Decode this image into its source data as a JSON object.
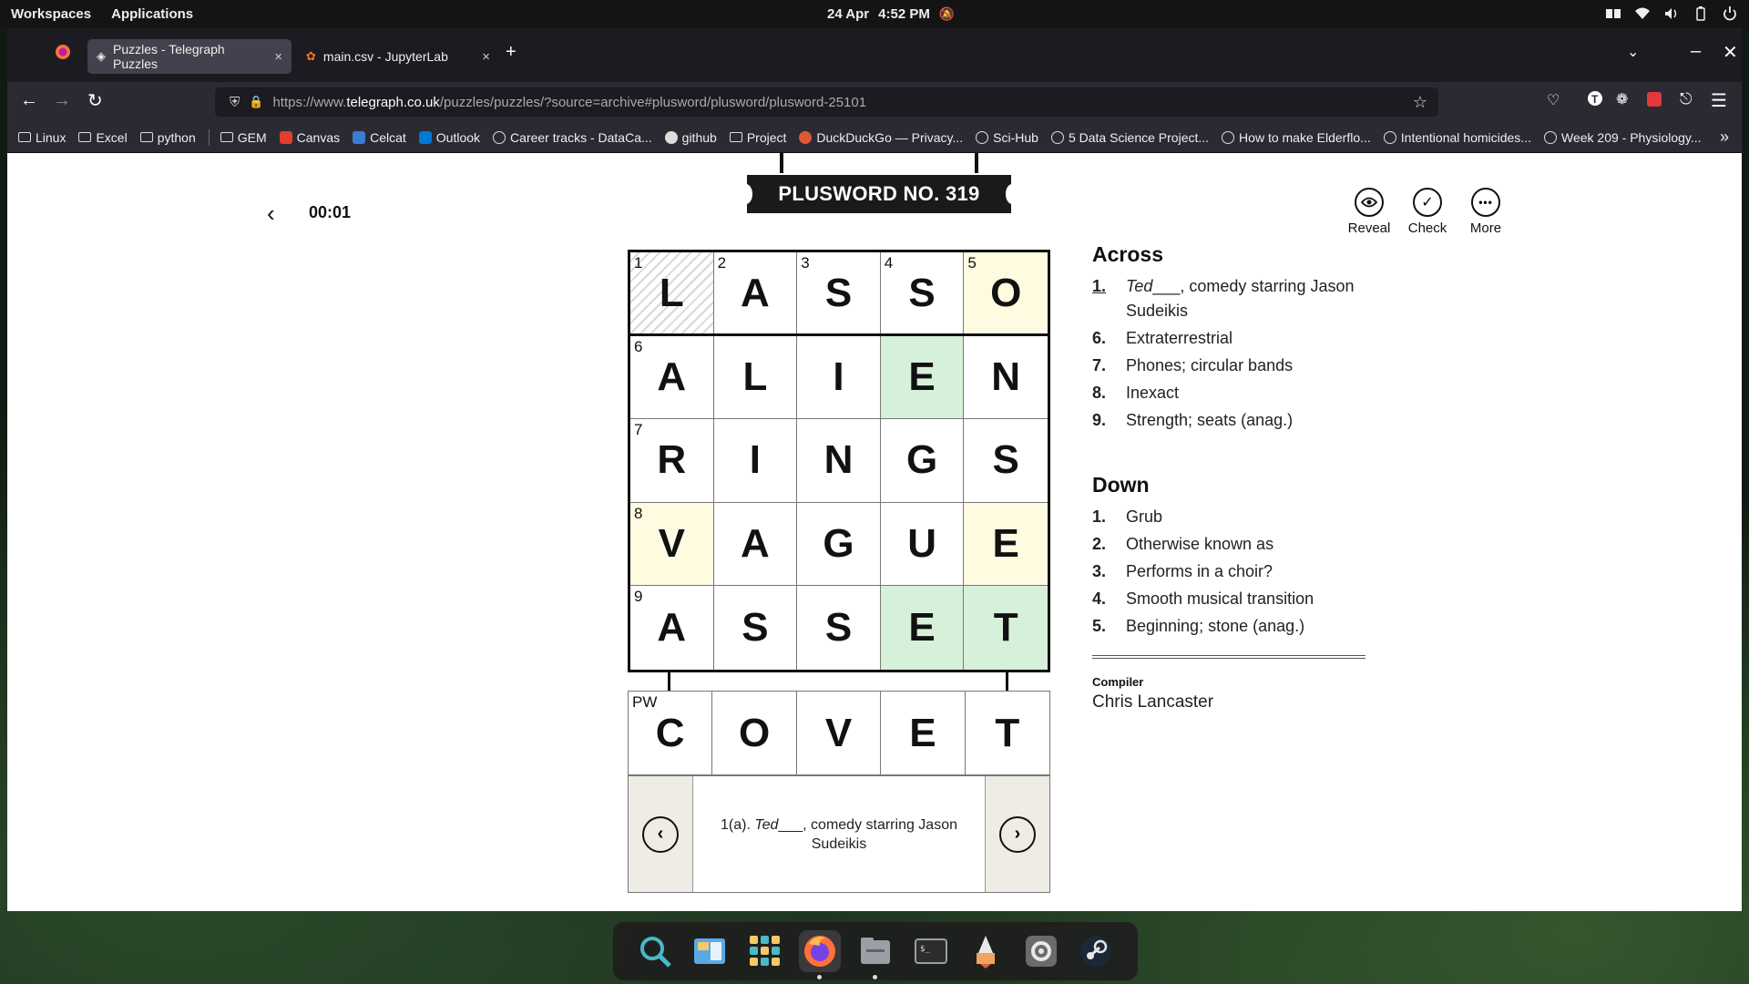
{
  "topbar": {
    "workspaces": "Workspaces",
    "applications": "Applications",
    "date": "24 Apr",
    "time": "4:52 PM"
  },
  "browser": {
    "tabs": [
      {
        "title": "Puzzles - Telegraph Puzzles",
        "close": "×"
      },
      {
        "title": "main.csv - JupyterLab",
        "close": "×"
      }
    ],
    "new_tab": "+",
    "url_prefix": "https://www.",
    "url_domain": "telegraph.co.uk",
    "url_path": "/puzzles/puzzles/?source=archive#plusword/plusword/plusword-25101",
    "bookmarks": [
      {
        "label": "Linux",
        "icon": "folder-icon"
      },
      {
        "label": "Excel",
        "icon": "folder-icon"
      },
      {
        "label": "python",
        "icon": "folder-icon"
      },
      {
        "label": "GEM",
        "icon": "folder-icon"
      },
      {
        "label": "Canvas",
        "icon": "canvas-icon"
      },
      {
        "label": "Celcat",
        "icon": "celcat-icon"
      },
      {
        "label": "Outlook",
        "icon": "outlook-icon"
      },
      {
        "label": "Career tracks - DataCa...",
        "icon": "globe-icon"
      },
      {
        "label": "github",
        "icon": "github-icon"
      },
      {
        "label": "Project",
        "icon": "folder-icon"
      },
      {
        "label": "DuckDuckGo — Privacy...",
        "icon": "duckduckgo-icon"
      },
      {
        "label": "Sci-Hub",
        "icon": "globe-icon"
      },
      {
        "label": "5 Data Science Project...",
        "icon": "globe-icon"
      },
      {
        "label": "How to make Elderflo...",
        "icon": "globe-icon"
      },
      {
        "label": "Intentional homicides...",
        "icon": "globe-icon"
      },
      {
        "label": "Week 209 - Physiology...",
        "icon": "globe-icon"
      }
    ],
    "overflow": "»"
  },
  "puzzle": {
    "timer": "00:01",
    "title": "PLUSWORD NO. 319",
    "actions": [
      {
        "label": "Reveal",
        "icon": "eye-icon"
      },
      {
        "label": "Check",
        "icon": "check-icon"
      },
      {
        "label": "More",
        "icon": "more-icon"
      }
    ],
    "grid": [
      [
        {
          "l": "L",
          "n": "1",
          "s": "selected"
        },
        {
          "l": "A",
          "n": "2",
          "s": ""
        },
        {
          "l": "S",
          "n": "3",
          "s": ""
        },
        {
          "l": "S",
          "n": "4",
          "s": ""
        },
        {
          "l": "O",
          "n": "5",
          "s": "hl-yellow"
        }
      ],
      [
        {
          "l": "A",
          "n": "6",
          "s": ""
        },
        {
          "l": "L",
          "n": "",
          "s": ""
        },
        {
          "l": "I",
          "n": "",
          "s": ""
        },
        {
          "l": "E",
          "n": "",
          "s": "hl-green"
        },
        {
          "l": "N",
          "n": "",
          "s": ""
        }
      ],
      [
        {
          "l": "R",
          "n": "7",
          "s": ""
        },
        {
          "l": "I",
          "n": "",
          "s": ""
        },
        {
          "l": "N",
          "n": "",
          "s": ""
        },
        {
          "l": "G",
          "n": "",
          "s": ""
        },
        {
          "l": "S",
          "n": "",
          "s": ""
        }
      ],
      [
        {
          "l": "V",
          "n": "8",
          "s": "hl-yellow"
        },
        {
          "l": "A",
          "n": "",
          "s": ""
        },
        {
          "l": "G",
          "n": "",
          "s": ""
        },
        {
          "l": "U",
          "n": "",
          "s": ""
        },
        {
          "l": "E",
          "n": "",
          "s": "hl-yellow"
        }
      ],
      [
        {
          "l": "A",
          "n": "9",
          "s": ""
        },
        {
          "l": "S",
          "n": "",
          "s": ""
        },
        {
          "l": "S",
          "n": "",
          "s": ""
        },
        {
          "l": "E",
          "n": "",
          "s": "hl-green"
        },
        {
          "l": "T",
          "n": "",
          "s": "hl-green"
        }
      ]
    ],
    "plusword_row": {
      "label": "PW",
      "letters": [
        "C",
        "O",
        "V",
        "E",
        "T"
      ]
    },
    "current_clue": {
      "prefix": "1(a).",
      "italic": "Ted",
      "rest": "___, comedy starring Jason Sudeikis"
    },
    "across_heading": "Across",
    "across": [
      {
        "num": "1.",
        "italic": "Ted",
        "text": "___, comedy starring Jason Sudeikis"
      },
      {
        "num": "6.",
        "italic": "",
        "text": "Extraterrestrial"
      },
      {
        "num": "7.",
        "italic": "",
        "text": "Phones; circular bands"
      },
      {
        "num": "8.",
        "italic": "",
        "text": "Inexact"
      },
      {
        "num": "9.",
        "italic": "",
        "text": "Strength; seats (anag.)"
      }
    ],
    "down_heading": "Down",
    "down": [
      {
        "num": "1.",
        "italic": "",
        "text": "Grub"
      },
      {
        "num": "2.",
        "italic": "",
        "text": "Otherwise known as"
      },
      {
        "num": "3.",
        "italic": "",
        "text": "Performs in a choir?"
      },
      {
        "num": "4.",
        "italic": "",
        "text": "Smooth musical transition"
      },
      {
        "num": "5.",
        "italic": "",
        "text": "Beginning; stone (anag.)"
      }
    ],
    "compiler_label": "Compiler",
    "compiler_name": "Chris Lancaster"
  },
  "dock": {
    "items": [
      "search-icon",
      "workspaces-icon",
      "app-grid-icon",
      "firefox-icon",
      "files-icon",
      "terminal-icon",
      "launcher-icon",
      "settings-icon",
      "steam-icon"
    ]
  }
}
